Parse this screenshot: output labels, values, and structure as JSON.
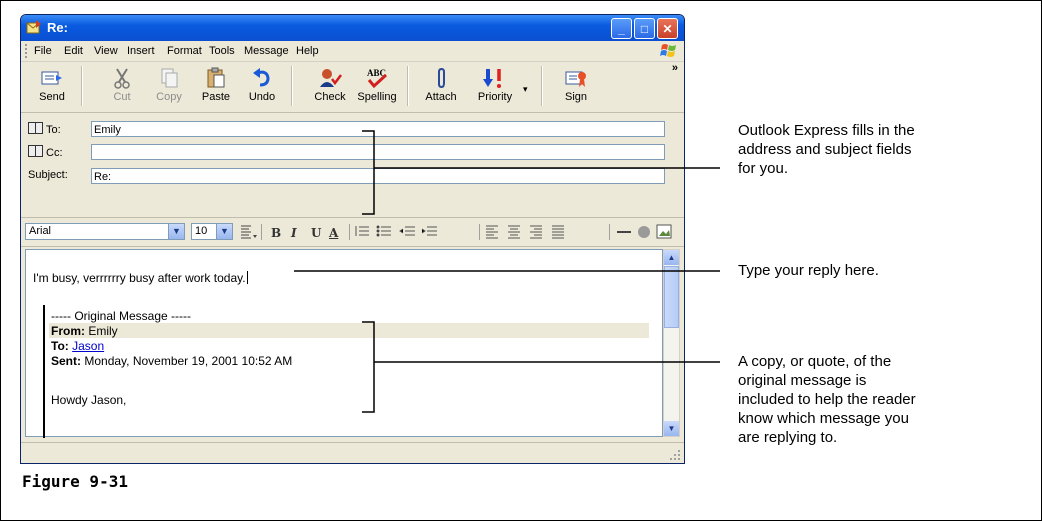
{
  "window": {
    "title": "Re:",
    "menu": [
      "File",
      "Edit",
      "View",
      "Insert",
      "Format",
      "Tools",
      "Message",
      "Help"
    ],
    "toolbar": [
      {
        "label": "Send",
        "icon": "send-icon",
        "enabled": true
      },
      {
        "label": "Cut",
        "icon": "cut-icon",
        "enabled": false
      },
      {
        "label": "Copy",
        "icon": "copy-icon",
        "enabled": false
      },
      {
        "label": "Paste",
        "icon": "paste-icon",
        "enabled": true
      },
      {
        "label": "Undo",
        "icon": "undo-icon",
        "enabled": true
      },
      {
        "label": "Check",
        "icon": "check-names-icon",
        "enabled": true
      },
      {
        "label": "Spelling",
        "icon": "spelling-icon",
        "enabled": true
      },
      {
        "label": "Attach",
        "icon": "paperclip-icon",
        "enabled": true
      },
      {
        "label": "Priority",
        "icon": "priority-icon",
        "enabled": true
      },
      {
        "label": "Sign",
        "icon": "sign-icon",
        "enabled": true
      }
    ],
    "overflow": "»"
  },
  "header": {
    "to_label": "To:",
    "to_value": "Emily",
    "cc_label": "Cc:",
    "cc_value": "",
    "subject_label": "Subject:",
    "subject_value": "Re:"
  },
  "format": {
    "font": "Arial",
    "size": "10",
    "bold": "B",
    "italic": "I",
    "underline": "U",
    "color": "A"
  },
  "message": {
    "reply": "I'm busy, verrrrrry busy after work today.",
    "original_header": "----- Original Message -----",
    "from_label": "From:",
    "from_value": "Emily",
    "to_label": "To:",
    "to_value": "Jason",
    "sent_label": "Sent:",
    "sent_value": "Monday, November 19, 2001 10:52 AM",
    "greeting": "Howdy Jason,"
  },
  "callouts": {
    "fields": [
      "Outlook Express fills in the",
      "address and subject fields",
      "for you."
    ],
    "reply": [
      "Type your reply here."
    ],
    "quote": [
      "A copy, or quote, of the",
      "original message is",
      "included to help the reader",
      "know which message you",
      "are replying to."
    ]
  },
  "figure_label": "Figure 9-31",
  "colors": {
    "titlebar": "#0a5ae0",
    "link": "#0000cc",
    "highlight": "#ece9d8"
  }
}
